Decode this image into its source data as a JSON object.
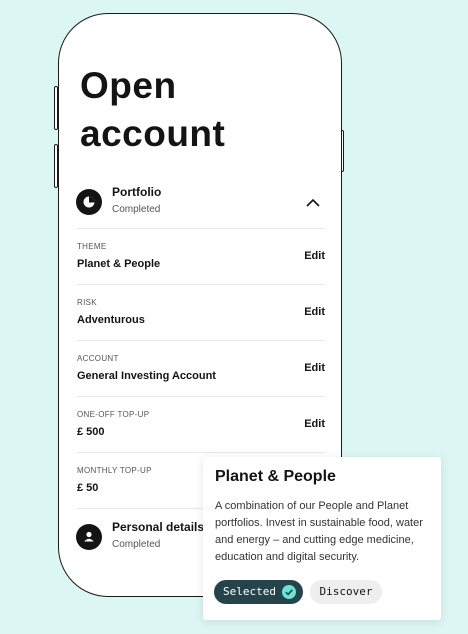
{
  "page": {
    "title": "Open account"
  },
  "portfolio_section": {
    "title": "Portfolio",
    "status": "Completed",
    "icon": "pie-chart-icon",
    "toggle_icon": "chevron-up-icon"
  },
  "rows": [
    {
      "label": "THEME",
      "value": "Planet & People",
      "action": "Edit"
    },
    {
      "label": "RISK",
      "value": "Adventurous",
      "action": "Edit"
    },
    {
      "label": "ACCOUNT",
      "value": "General Investing Account",
      "action": "Edit"
    },
    {
      "label": "ONE-OFF TOP-UP",
      "value": "£ 500",
      "action": "Edit"
    },
    {
      "label": "MONTHLY TOP-UP",
      "value": "£ 50"
    }
  ],
  "personal_section": {
    "title": "Personal details",
    "status": "Completed",
    "icon": "person-icon"
  },
  "theme_card": {
    "title": "Planet & People",
    "description": "A combination of our People and Planet portfolios. Invest in sustainable food, water and energy – and cutting edge medicine, education and digital security.",
    "selected_label": "Selected",
    "discover_label": "Discover"
  },
  "colors": {
    "background": "#dcf6f4",
    "selected_pill": "#24434a",
    "check_accent": "#69e4d5",
    "text": "#141414"
  }
}
